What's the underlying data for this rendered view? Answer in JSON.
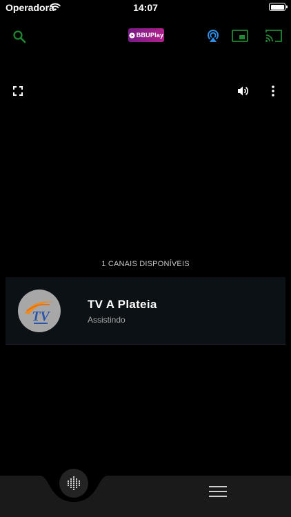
{
  "status_bar": {
    "carrier": "Operadora",
    "time": "14:07"
  },
  "header": {
    "logo_text": "BBUPlay"
  },
  "player": {},
  "channels": {
    "count_label": "1 CANAIS DISPONÍVEIS",
    "items": [
      {
        "name": "TV A Plateia",
        "status": "Assistindo",
        "logo_text": "TV"
      }
    ]
  },
  "colors": {
    "accent_green": "#1f8a34",
    "airplay_blue": "#2f8fe6",
    "card_bg": "#0c1116"
  },
  "icons": [
    "wifi-icon",
    "battery-icon",
    "search-icon",
    "airplay-icon",
    "pip-icon",
    "cast-icon",
    "fullscreen-icon",
    "volume-icon",
    "more-vertical-icon",
    "dots-grid-icon",
    "menu-icon"
  ]
}
